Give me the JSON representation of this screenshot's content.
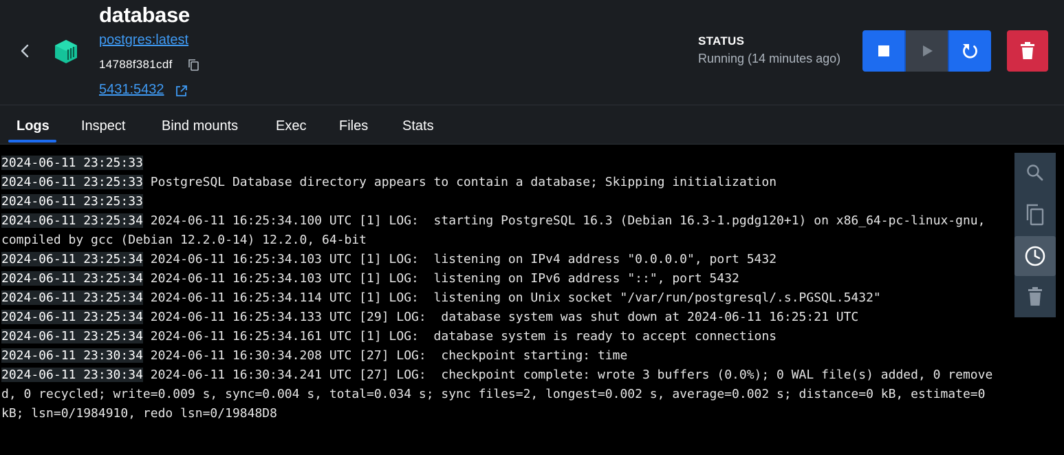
{
  "header": {
    "title": "database",
    "image": "postgres:latest",
    "container_id": "14788f381cdf",
    "ports": "5431:5432",
    "status_label": "STATUS",
    "status_value": "Running (14 minutes ago)",
    "accent_color": "#1d6cf0",
    "danger_color": "#d22b45",
    "container_icon_color": "#15c39a"
  },
  "icons": {
    "back": "chevron-left-icon",
    "container": "container-icon",
    "copy": "copy-icon",
    "external": "external-link-icon",
    "stop": "stop-icon",
    "start": "play-icon",
    "restart": "restart-icon",
    "delete": "trash-icon"
  },
  "tabs": [
    {
      "label": "Logs",
      "active": true
    },
    {
      "label": "Inspect"
    },
    {
      "label": "Bind mounts"
    },
    {
      "label": "Exec"
    },
    {
      "label": "Files"
    },
    {
      "label": "Stats"
    }
  ],
  "logs": [
    {
      "ts": "2024-06-11 23:25:33",
      "msg": ""
    },
    {
      "ts": "2024-06-11 23:25:33",
      "msg": "PostgreSQL Database directory appears to contain a database; Skipping initialization"
    },
    {
      "ts": "2024-06-11 23:25:33",
      "msg": ""
    },
    {
      "ts": "2024-06-11 23:25:34",
      "msg": "2024-06-11 16:25:34.100 UTC [1] LOG:  starting PostgreSQL 16.3 (Debian 16.3-1.pgdg120+1) on x86_64-pc-linux-gnu,"
    },
    {
      "ts": "",
      "msg": "compiled by gcc (Debian 12.2.0-14) 12.2.0, 64-bit"
    },
    {
      "ts": "2024-06-11 23:25:34",
      "msg": "2024-06-11 16:25:34.103 UTC [1] LOG:  listening on IPv4 address \"0.0.0.0\", port 5432"
    },
    {
      "ts": "2024-06-11 23:25:34",
      "msg": "2024-06-11 16:25:34.103 UTC [1] LOG:  listening on IPv6 address \"::\", port 5432"
    },
    {
      "ts": "2024-06-11 23:25:34",
      "msg": "2024-06-11 16:25:34.114 UTC [1] LOG:  listening on Unix socket \"/var/run/postgresql/.s.PGSQL.5432\""
    },
    {
      "ts": "2024-06-11 23:25:34",
      "msg": "2024-06-11 16:25:34.133 UTC [29] LOG:  database system was shut down at 2024-06-11 16:25:21 UTC"
    },
    {
      "ts": "2024-06-11 23:25:34",
      "msg": "2024-06-11 16:25:34.161 UTC [1] LOG:  database system is ready to accept connections"
    },
    {
      "ts": "2024-06-11 23:30:34",
      "msg": "2024-06-11 16:30:34.208 UTC [27] LOG:  checkpoint starting: time"
    },
    {
      "ts": "2024-06-11 23:30:34",
      "msg": "2024-06-11 16:30:34.241 UTC [27] LOG:  checkpoint complete: wrote 3 buffers (0.0%); 0 WAL file(s) added, 0 remove"
    },
    {
      "ts": "",
      "msg": "d, 0 recycled; write=0.009 s, sync=0.004 s, total=0.034 s; sync files=2, longest=0.002 s, average=0.002 s; distance=0 kB, estimate=0"
    },
    {
      "ts": "",
      "msg": "kB; lsn=0/1984910, redo lsn=0/19848D8"
    }
  ],
  "toolbar": [
    {
      "icon": "search-icon",
      "active": false
    },
    {
      "icon": "copy-icon",
      "active": false
    },
    {
      "icon": "clock-icon",
      "active": true
    },
    {
      "icon": "trash-icon",
      "active": false
    }
  ]
}
